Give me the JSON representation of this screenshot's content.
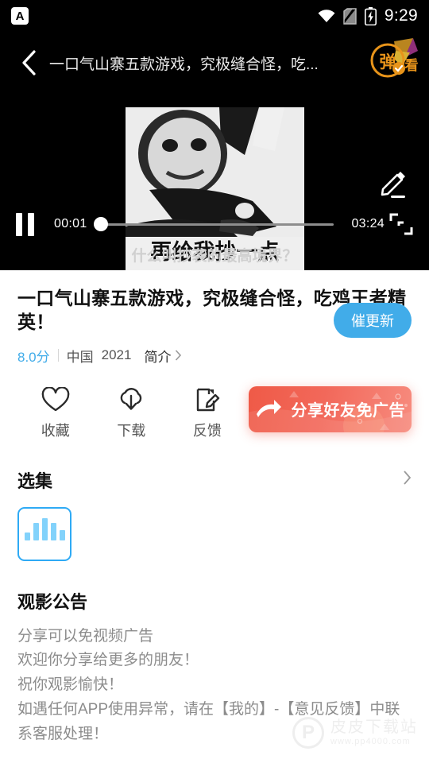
{
  "status_bar": {
    "app_icon": "app-notification-icon",
    "app_icon_letter": "A",
    "wifi_icon": "wifi-icon",
    "sim_icon": "sim-card-off-icon",
    "battery_icon": "battery-charging-icon",
    "time": "9:29"
  },
  "player": {
    "back_icon": "back-chevron-icon",
    "title": "一口气山寨五款游戏，究极缝合怪，吃...",
    "brand_badge_text": "弹",
    "brand_badge_sub": "看",
    "brand_badge_icon": "danmaku-watch-badge-icon",
    "edit_icon": "pencil-edit-icon",
    "pause_icon": "pause-icon",
    "current_time": "00:01",
    "duration": "03:24",
    "progress_percent": 0.5,
    "fullscreen_icon": "fullscreen-icon",
    "meme_caption": "再给我抄一点",
    "subtitle": "什么叫抄袭的最高境界？"
  },
  "info": {
    "title": "一口气山寨五款游戏，究极缝合怪，吃鸡王者精英！",
    "urge_update_label": "催更新",
    "score": "8.0分",
    "region": "中国",
    "year": "2021",
    "intro_label": "简介",
    "intro_arrow": "chevron-right-icon"
  },
  "actions": [
    {
      "icon": "heart-icon",
      "label": "收藏"
    },
    {
      "icon": "cloud-download-icon",
      "label": "下载"
    },
    {
      "icon": "feedback-edit-icon",
      "label": "反馈"
    }
  ],
  "share_button": {
    "icon": "share-arrow-icon",
    "label": "分享好友免广告",
    "color_start": "#ef5a47",
    "color_end": "#f78b7e"
  },
  "episodes_section": {
    "title": "选集",
    "arrow_icon": "chevron-right-icon",
    "cards": [
      {
        "state": "playing",
        "icon": "playing-bars-icon",
        "border_color": "#2eaaf5",
        "bar_color": "#82d2fb"
      }
    ]
  },
  "notice_section": {
    "title": "观影公告",
    "lines": [
      "分享可以免视频广告",
      "欢迎你分享给更多的朋友！",
      "祝你观影愉快！",
      "如遇任何APP使用异常，请在【我的】-【意见反馈】中联系客服处理！"
    ]
  },
  "watermark": {
    "logo_letter": "P",
    "name": "皮皮下载站",
    "url": "www.pp4000.com"
  },
  "theme": {
    "accent_blue": "#41ace9",
    "episode_blue": "#2eaaf5",
    "share_red": "#ef5a47"
  }
}
